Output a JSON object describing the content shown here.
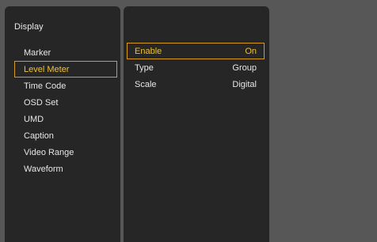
{
  "colors": {
    "background": "#575757",
    "panel": "#262626",
    "text": "#e6e6e6",
    "highlight_border": "#d99a1a",
    "highlight_text": "#f2c12e"
  },
  "menu": {
    "title": "Display",
    "items": [
      {
        "label": "Marker",
        "selected": false
      },
      {
        "label": "Level Meter",
        "selected": true
      },
      {
        "label": "Time Code",
        "selected": false
      },
      {
        "label": "OSD Set",
        "selected": false
      },
      {
        "label": "UMD",
        "selected": false
      },
      {
        "label": "Caption",
        "selected": false
      },
      {
        "label": "Video Range",
        "selected": false
      },
      {
        "label": "Waveform",
        "selected": false
      }
    ]
  },
  "settings": {
    "rows": [
      {
        "label": "Enable",
        "value": "On",
        "selected": true
      },
      {
        "label": "Type",
        "value": "Group",
        "selected": false
      },
      {
        "label": "Scale",
        "value": "Digital",
        "selected": false
      }
    ]
  }
}
